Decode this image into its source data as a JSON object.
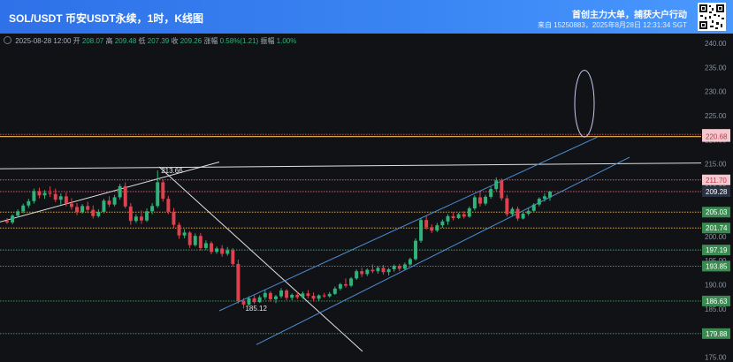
{
  "header": {
    "title": "SOL/USDT 币安USDT永续，1时，K线图",
    "slogan": "首创主力大单，捕获大户行动",
    "subline": "来自 15250883，2025年8月28日 12:31:34 SGT"
  },
  "ohlc": {
    "date": "2025-08-28 12:00",
    "open_label": "开",
    "open": "208.07",
    "high_label": "高",
    "high": "209.48",
    "low_label": "低",
    "low": "207.39",
    "close_label": "收",
    "close": "209.26",
    "change_label": "涨幅",
    "change": "0.58%(1.21)",
    "amp_label": "振幅",
    "amp": "1.00%"
  },
  "colors": {
    "up": "#2fb37a",
    "down": "#e0414e",
    "channel": "#4d8fd6",
    "red_level": "#e05a6b",
    "gold_level": "#d6a84a",
    "green_level": "#3fae5f",
    "white_line": "#e0e0e0",
    "ellipse": "#c7c9ee"
  },
  "chart_data": {
    "type": "candlestick",
    "y_axis_ticks": [
      240,
      235,
      230,
      225,
      220,
      215,
      210,
      205,
      200,
      195,
      190,
      185,
      180,
      175
    ],
    "ylim": [
      174,
      242
    ],
    "grid": false,
    "price_lines": [
      {
        "value": 221.13,
        "label": "221.13",
        "kind": "resistance"
      },
      {
        "value": 220.68,
        "label": "220.68",
        "kind": "resistance"
      },
      {
        "value": 211.7,
        "label": "211.70",
        "kind": "resistance"
      },
      {
        "value": 209.28,
        "label": "209.28",
        "kind": "current"
      },
      {
        "value": 205.03,
        "label": "205.03",
        "kind": "support"
      },
      {
        "value": 201.74,
        "label": "201.74",
        "kind": "support"
      },
      {
        "value": 197.19,
        "label": "197.19",
        "kind": "support"
      },
      {
        "value": 193.85,
        "label": "193.85",
        "kind": "support"
      },
      {
        "value": 186.63,
        "label": "186.63",
        "kind": "support"
      },
      {
        "value": 179.88,
        "label": "179.88",
        "kind": "support"
      }
    ],
    "annotations": [
      {
        "text": "213.66",
        "value": 213.66,
        "type": "swing-high"
      },
      {
        "text": "185.12",
        "value": 185.12,
        "type": "swing-low"
      }
    ],
    "candles": [
      [
        203.2,
        203.8,
        202.6,
        202.9
      ],
      [
        202.9,
        204.6,
        202.5,
        204.3
      ],
      [
        204.3,
        205.6,
        203.9,
        205.2
      ],
      [
        205.2,
        206.8,
        204.8,
        206.4
      ],
      [
        206.4,
        207.8,
        205.9,
        207.3
      ],
      [
        207.3,
        209.9,
        206.8,
        209.4
      ],
      [
        209.4,
        210.1,
        207.9,
        208.5
      ],
      [
        208.5,
        209.6,
        207.8,
        209.0
      ],
      [
        209.0,
        210.4,
        208.2,
        208.8
      ],
      [
        208.8,
        209.9,
        207.1,
        207.6
      ],
      [
        207.6,
        208.9,
        206.6,
        208.3
      ],
      [
        208.3,
        209.1,
        206.2,
        206.8
      ],
      [
        206.8,
        207.9,
        205.5,
        206.1
      ],
      [
        206.1,
        206.9,
        204.4,
        205.0
      ],
      [
        205.0,
        206.7,
        204.7,
        206.3
      ],
      [
        206.3,
        207.2,
        204.8,
        205.5
      ],
      [
        205.5,
        206.4,
        203.7,
        204.2
      ],
      [
        204.2,
        205.6,
        203.9,
        205.1
      ],
      [
        205.1,
        207.8,
        204.8,
        207.4
      ],
      [
        207.4,
        208.3,
        206.1,
        206.6
      ],
      [
        206.6,
        208.6,
        206.2,
        208.1
      ],
      [
        208.1,
        210.9,
        207.6,
        210.4
      ],
      [
        210.4,
        211.2,
        205.8,
        206.2
      ],
      [
        206.2,
        206.9,
        202.4,
        203.2
      ],
      [
        203.2,
        204.6,
        202.8,
        204.1
      ],
      [
        204.1,
        205.4,
        202.6,
        203.3
      ],
      [
        203.3,
        205.8,
        203.0,
        205.2
      ],
      [
        205.2,
        206.9,
        204.6,
        206.3
      ],
      [
        206.3,
        213.66,
        205.9,
        211.2
      ],
      [
        211.2,
        211.8,
        207.2,
        207.8
      ],
      [
        207.8,
        208.4,
        204.6,
        205.1
      ],
      [
        205.1,
        205.9,
        201.8,
        202.4
      ],
      [
        202.4,
        202.9,
        199.5,
        200.2
      ],
      [
        200.2,
        201.5,
        199.6,
        200.8
      ],
      [
        200.8,
        201.1,
        197.6,
        198.2
      ],
      [
        198.2,
        200.6,
        197.9,
        200.1
      ],
      [
        200.1,
        200.7,
        197.1,
        197.6
      ],
      [
        197.6,
        199.2,
        197.2,
        198.6
      ],
      [
        198.6,
        199.0,
        196.3,
        196.8
      ],
      [
        196.8,
        197.9,
        196.4,
        197.5
      ],
      [
        197.5,
        198.2,
        195.8,
        196.4
      ],
      [
        196.4,
        197.8,
        196.0,
        197.1
      ],
      [
        197.1,
        197.6,
        193.8,
        194.3
      ],
      [
        194.3,
        195.2,
        186.1,
        186.7
      ],
      [
        186.7,
        187.2,
        185.12,
        185.9
      ],
      [
        185.9,
        187.6,
        185.6,
        187.2
      ],
      [
        187.2,
        188.0,
        186.0,
        186.4
      ],
      [
        186.4,
        187.8,
        186.2,
        187.4
      ],
      [
        187.4,
        188.9,
        186.9,
        188.3
      ],
      [
        188.3,
        188.7,
        186.5,
        187.0
      ],
      [
        187.0,
        187.9,
        186.2,
        187.6
      ],
      [
        187.6,
        189.3,
        187.2,
        188.8
      ],
      [
        188.8,
        189.1,
        186.8,
        187.3
      ],
      [
        187.3,
        188.2,
        186.8,
        187.9
      ],
      [
        187.9,
        188.5,
        187.0,
        187.4
      ],
      [
        187.4,
        188.6,
        187.1,
        188.2
      ],
      [
        188.2,
        188.9,
        187.2,
        187.7
      ],
      [
        187.7,
        188.4,
        186.6,
        187.1
      ],
      [
        187.1,
        188.0,
        186.7,
        187.8
      ],
      [
        187.8,
        188.3,
        187.3,
        187.6
      ],
      [
        187.6,
        188.5,
        187.3,
        188.1
      ],
      [
        188.1,
        189.6,
        187.9,
        189.2
      ],
      [
        189.2,
        190.4,
        188.8,
        190.1
      ],
      [
        190.1,
        191.3,
        189.4,
        189.8
      ],
      [
        189.8,
        191.6,
        189.5,
        191.3
      ],
      [
        191.3,
        193.2,
        191.0,
        192.8
      ],
      [
        192.8,
        193.5,
        191.6,
        192.2
      ],
      [
        192.2,
        193.4,
        191.8,
        193.1
      ],
      [
        193.1,
        194.2,
        192.4,
        192.8
      ],
      [
        192.8,
        193.9,
        192.3,
        193.5
      ],
      [
        193.5,
        194.1,
        192.1,
        192.6
      ],
      [
        192.6,
        193.5,
        191.9,
        193.2
      ],
      [
        193.2,
        194.2,
        192.7,
        193.9
      ],
      [
        193.9,
        194.3,
        192.8,
        193.3
      ],
      [
        193.3,
        194.6,
        193.0,
        194.2
      ],
      [
        194.2,
        195.6,
        193.9,
        195.3
      ],
      [
        195.3,
        199.6,
        195.0,
        199.1
      ],
      [
        199.1,
        203.8,
        198.7,
        203.4
      ],
      [
        203.4,
        204.2,
        201.4,
        201.9
      ],
      [
        201.9,
        202.5,
        200.7,
        201.2
      ],
      [
        201.2,
        202.8,
        200.9,
        202.3
      ],
      [
        202.3,
        203.5,
        201.8,
        203.1
      ],
      [
        203.1,
        204.6,
        202.4,
        204.2
      ],
      [
        204.2,
        205.0,
        203.3,
        203.8
      ],
      [
        203.8,
        204.9,
        203.6,
        204.6
      ],
      [
        204.6,
        205.2,
        203.7,
        204.1
      ],
      [
        204.1,
        206.2,
        203.9,
        205.8
      ],
      [
        205.8,
        208.5,
        205.4,
        208.1
      ],
      [
        208.1,
        209.3,
        206.2,
        206.8
      ],
      [
        206.8,
        208.6,
        206.4,
        208.2
      ],
      [
        208.2,
        210.3,
        207.8,
        209.8
      ],
      [
        209.8,
        212.2,
        209.4,
        211.6
      ],
      [
        211.6,
        212.0,
        207.4,
        207.9
      ],
      [
        207.9,
        208.6,
        204.1,
        204.6
      ],
      [
        204.6,
        206.1,
        204.2,
        205.7
      ],
      [
        205.7,
        206.2,
        203.2,
        203.7
      ],
      [
        203.7,
        205.1,
        203.5,
        204.7
      ],
      [
        204.7,
        205.9,
        204.3,
        205.3
      ],
      [
        205.3,
        206.9,
        205.0,
        206.6
      ],
      [
        206.6,
        208.1,
        206.2,
        207.8
      ],
      [
        207.8,
        208.9,
        207.2,
        208.3
      ],
      [
        208.07,
        209.48,
        207.39,
        209.26
      ]
    ]
  }
}
